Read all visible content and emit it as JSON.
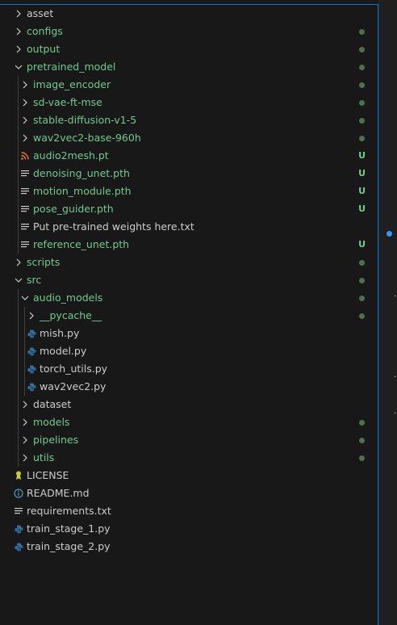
{
  "explorer": {
    "rows": [
      {
        "label": "asset",
        "depth": 0,
        "kind": "folder",
        "status": "",
        "git": ""
      },
      {
        "label": "configs",
        "depth": 0,
        "kind": "folder",
        "status": "dot",
        "git": "green"
      },
      {
        "label": "output",
        "depth": 0,
        "kind": "folder",
        "status": "dot",
        "git": "green"
      },
      {
        "label": "pretrained_model",
        "depth": 0,
        "kind": "folder-open",
        "status": "dot",
        "git": "green"
      },
      {
        "label": "image_encoder",
        "depth": 1,
        "kind": "folder",
        "status": "dot",
        "git": "green"
      },
      {
        "label": "sd-vae-ft-mse",
        "depth": 1,
        "kind": "folder",
        "status": "dot",
        "git": "green"
      },
      {
        "label": "stable-diffusion-v1-5",
        "depth": 1,
        "kind": "folder",
        "status": "dot",
        "git": "green"
      },
      {
        "label": "wav2vec2-base-960h",
        "depth": 1,
        "kind": "folder",
        "status": "dot",
        "git": "green"
      },
      {
        "label": "audio2mesh.pt",
        "depth": 1,
        "kind": "rss",
        "status": "U",
        "git": "green"
      },
      {
        "label": "denoising_unet.pth",
        "depth": 1,
        "kind": "lines",
        "status": "U",
        "git": "green"
      },
      {
        "label": "motion_module.pth",
        "depth": 1,
        "kind": "lines",
        "status": "U",
        "git": "green"
      },
      {
        "label": "pose_guider.pth",
        "depth": 1,
        "kind": "lines",
        "status": "U",
        "git": "green"
      },
      {
        "label": "Put pre-trained weights here.txt",
        "depth": 1,
        "kind": "lines",
        "status": "",
        "git": ""
      },
      {
        "label": "reference_unet.pth",
        "depth": 1,
        "kind": "lines",
        "status": "U",
        "git": "green"
      },
      {
        "label": "scripts",
        "depth": 0,
        "kind": "folder",
        "status": "dot",
        "git": "green"
      },
      {
        "label": "src",
        "depth": 0,
        "kind": "folder-open",
        "status": "dot",
        "git": "green"
      },
      {
        "label": "audio_models",
        "depth": 1,
        "kind": "folder-open",
        "status": "dot",
        "git": "green"
      },
      {
        "label": "__pycache__",
        "depth": 2,
        "kind": "folder",
        "status": "dot",
        "git": "green"
      },
      {
        "label": "mish.py",
        "depth": 2,
        "kind": "python",
        "status": "",
        "git": ""
      },
      {
        "label": "model.py",
        "depth": 2,
        "kind": "python",
        "status": "",
        "git": ""
      },
      {
        "label": "torch_utils.py",
        "depth": 2,
        "kind": "python",
        "status": "",
        "git": ""
      },
      {
        "label": "wav2vec2.py",
        "depth": 2,
        "kind": "python",
        "status": "",
        "git": ""
      },
      {
        "label": "dataset",
        "depth": 1,
        "kind": "folder",
        "status": "",
        "git": ""
      },
      {
        "label": "models",
        "depth": 1,
        "kind": "folder",
        "status": "dot",
        "git": "green"
      },
      {
        "label": "pipelines",
        "depth": 1,
        "kind": "folder",
        "status": "dot",
        "git": "green"
      },
      {
        "label": "utils",
        "depth": 1,
        "kind": "folder",
        "status": "dot",
        "git": "green"
      },
      {
        "label": "LICENSE",
        "depth": 0,
        "kind": "license",
        "status": "",
        "git": ""
      },
      {
        "label": "README.md",
        "depth": 0,
        "kind": "info",
        "status": "",
        "git": ""
      },
      {
        "label": "requirements.txt",
        "depth": 0,
        "kind": "lines",
        "status": "",
        "git": ""
      },
      {
        "label": "train_stage_1.py",
        "depth": 0,
        "kind": "python",
        "status": "",
        "git": ""
      },
      {
        "label": "train_stage_2.py",
        "depth": 0,
        "kind": "python",
        "status": "",
        "git": ""
      }
    ]
  },
  "colors": {
    "background": "#181818",
    "text": "#cccccc",
    "git_untracked": "#73c991",
    "git_dot": "#4e6e55",
    "accent": "#0078d4",
    "python_icon": "#3572a5",
    "rss_icon": "#e37933",
    "license_icon": "#cbcb41",
    "info_icon": "#519aba"
  }
}
